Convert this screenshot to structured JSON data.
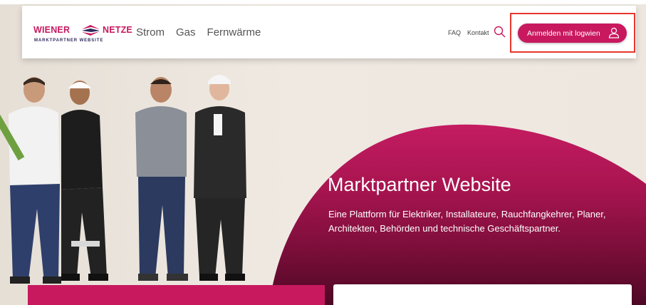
{
  "brand": {
    "word_left": "WIENER",
    "word_right": "NETZE",
    "subtitle": "MARKTPARTNER WEBSITE",
    "icon": "wiener-netze-logo-mark",
    "color": "#c8195f"
  },
  "nav": {
    "items": [
      "Strom",
      "Gas",
      "Fernwärme"
    ]
  },
  "utility": {
    "faq": "FAQ",
    "contact": "Kontakt",
    "search_icon": "search-icon"
  },
  "login": {
    "label": "Anmelden mit logwien",
    "icon": "user-icon",
    "highlight_color": "#e8362e"
  },
  "hero": {
    "title": "Marktpartner Website",
    "text": "Eine Plattform für Elektriker, Installateure, Rauchfangkehrer, Planer, Architekten, Behörden und technische Geschäftspartner.",
    "accent": "#c8195f",
    "accent_dark": "#5e0a2e"
  }
}
